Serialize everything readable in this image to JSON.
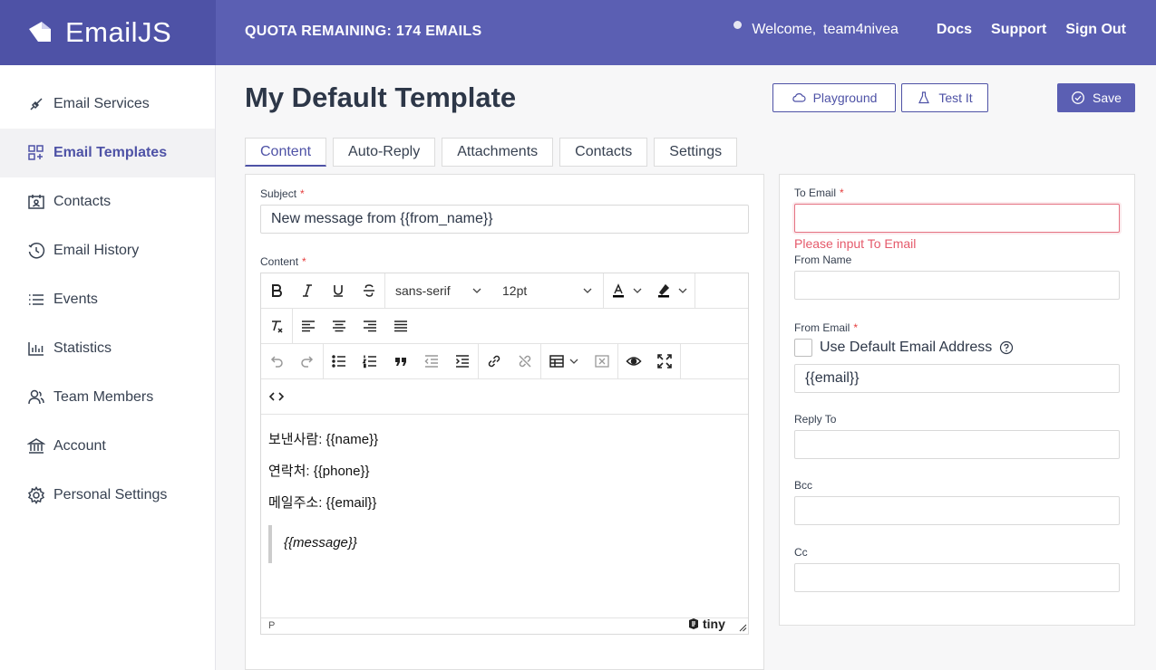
{
  "brand": {
    "name": "EmailJS"
  },
  "topbar": {
    "quota": "QUOTA REMAINING: 174 EMAILS",
    "welcome": "Welcome,",
    "user": "team4nivea",
    "docs": "Docs",
    "support": "Support",
    "signout": "Sign Out"
  },
  "sidebar": {
    "items": [
      {
        "label": "Email Services",
        "icon": "plug-icon"
      },
      {
        "label": "Email Templates",
        "icon": "templates-icon",
        "active": true
      },
      {
        "label": "Contacts",
        "icon": "contact-card-icon"
      },
      {
        "label": "Email History",
        "icon": "history-icon"
      },
      {
        "label": "Events",
        "icon": "list-icon"
      },
      {
        "label": "Statistics",
        "icon": "bar-chart-icon"
      },
      {
        "label": "Team Members",
        "icon": "users-icon"
      },
      {
        "label": "Account",
        "icon": "bank-icon"
      },
      {
        "label": "Personal Settings",
        "icon": "gear-icon"
      }
    ]
  },
  "page": {
    "title": "My Default Template",
    "playground": "Playground",
    "test": "Test It",
    "save": "Save"
  },
  "tabs": [
    "Content",
    "Auto-Reply",
    "Attachments",
    "Contacts",
    "Settings"
  ],
  "content": {
    "subject_label": "Subject",
    "subject_value": "New message from {{from_name}}",
    "content_label": "Content",
    "font_family": "sans-serif",
    "font_size": "12pt",
    "body_lines": [
      "보낸사람: {{name}}",
      "연락처: {{phone}}",
      "메일주소: {{email}}"
    ],
    "quote": "{{message}}",
    "status_path": "P",
    "tiny_brand": "tiny"
  },
  "right": {
    "to_email_label": "To Email",
    "to_email_error": "Please input To Email",
    "from_name_label": "From Name",
    "from_email_label": "From Email",
    "use_default_label": "Use Default Email Address",
    "from_email_value": "{{email}}",
    "reply_to_label": "Reply To",
    "bcc_label": "Bcc",
    "cc_label": "Cc"
  },
  "colors": {
    "brand": "#5b5fb3",
    "brand_dark": "#4e52a6",
    "error": "#e55a6b"
  }
}
